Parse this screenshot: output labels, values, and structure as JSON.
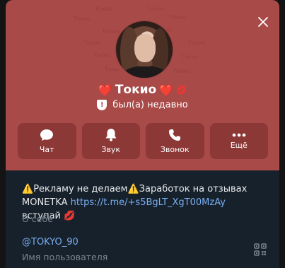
{
  "profile": {
    "name": "Токио",
    "name_prefix_emoji": "❤️",
    "name_suffix_emoji": "❤️",
    "name_extra_emoji": "💋",
    "badge": "!",
    "status": "был(а) недавно",
    "pattern_text": "Токио"
  },
  "actions": [
    {
      "label": "Чат",
      "icon": "chat-icon"
    },
    {
      "label": "Звук",
      "icon": "bell-icon"
    },
    {
      "label": "Звонок",
      "icon": "phone-icon"
    },
    {
      "label": "Ещё",
      "icon": "more-icon"
    }
  ],
  "bio": {
    "warn_emoji": "⚠️",
    "part1": "Рекламу не делаем",
    "part2": "Заработок на отзывах MONETKA ",
    "link": "https://t.me/+s5BgLT_XgT00MzAy",
    "part3": " вступай ",
    "kiss_emoji": "💋",
    "caption": "О себе"
  },
  "username": {
    "value": "@TOKYO_90",
    "caption": "Имя пользователя"
  },
  "colors": {
    "header_bg": "#a84a48",
    "button_bg": "#8c3836",
    "panel_bg": "#17212b",
    "link": "#79aef2",
    "secondary_text": "#7a8591"
  }
}
